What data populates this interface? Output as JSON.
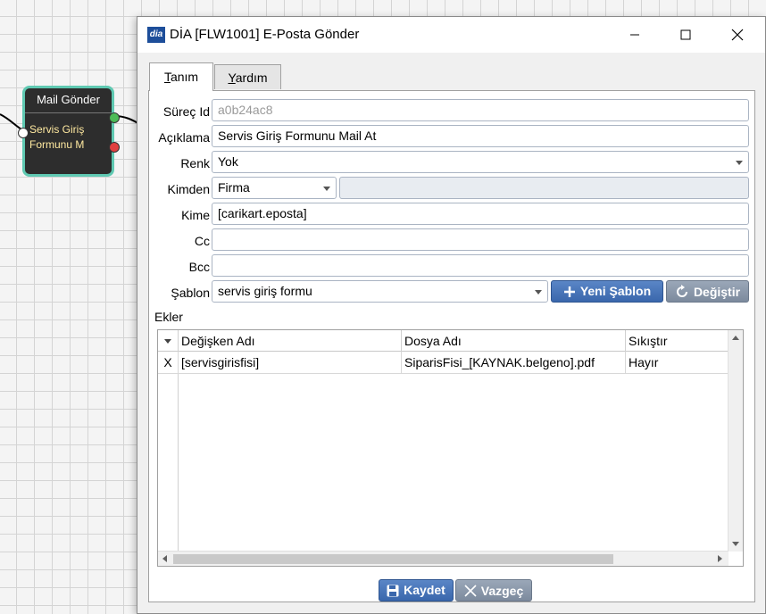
{
  "node": {
    "title": "Mail Gönder",
    "body_line1": "Servis Giriş",
    "body_line2": "Formunu M"
  },
  "window": {
    "logo": "dia",
    "title": "DİA [FLW1001] E-Posta Gönder"
  },
  "tabs": [
    {
      "label": "Tanım",
      "hotkey": "T",
      "rest": "anım"
    },
    {
      "label": "Yardım",
      "hotkey": "Y",
      "rest": "ardım"
    }
  ],
  "form": {
    "surec_label": "Süreç Id",
    "surec_value": "a0b24ac8",
    "aciklama_label": "Açıklama",
    "aciklama_value": "Servis Giriş Formunu Mail At",
    "renk_label": "Renk",
    "renk_value": "Yok",
    "kimden_label": "Kimden",
    "kimden_value": "Firma",
    "kimden_extra": "",
    "kime_label": "Kime",
    "kime_value": "[carikart.eposta]",
    "cc_label": "Cc",
    "cc_value": "",
    "bcc_label": "Bcc",
    "bcc_value": "",
    "sablon_label": "Şablon",
    "sablon_value": "servis giriş formu",
    "new_template_label": "Yeni Şablon",
    "change_label": "Değiştir"
  },
  "attachments": {
    "label": "Ekler",
    "columns": [
      "Değişken Adı",
      "Dosya Adı",
      "Sıkıştır"
    ],
    "rows": [
      {
        "marker": "X",
        "variable": "[servisgirisfisi]",
        "file": "SiparisFisi_[KAYNAK.belgeno].pdf",
        "compress": "Hayır"
      }
    ]
  },
  "footer": {
    "save_label": "Kaydet",
    "cancel_label": "Vazgeç"
  },
  "colors": {
    "accent": "#3a67ac",
    "node_border": "#5fc9b2",
    "node_bg": "#2d2d2d"
  }
}
